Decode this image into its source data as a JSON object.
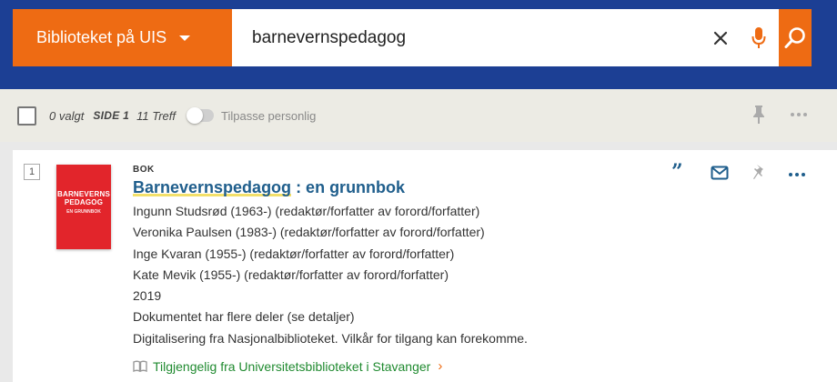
{
  "search": {
    "scope_label": "Biblioteket på UIS",
    "query": "barnevernspedagog"
  },
  "toolbar": {
    "selected": "0 valgt",
    "page": "SIDE 1",
    "hits": "11 Treff",
    "personalize_label": "Tilpasse personlig"
  },
  "results": [
    {
      "index": "1",
      "cover_title": "BARNEVERNS PEDAGOG",
      "cover_subtitle": "EN GRUNNBOK",
      "type": "BOK",
      "title_highlight": "Barnevernspedagog",
      "title_rest": " : en grunnbok",
      "details": [
        "Ingunn Studsrød (1963-) (redaktør/forfatter av forord/forfatter)",
        "Veronika Paulsen (1983-) (redaktør/forfatter av forord/forfatter)",
        "Inge Kvaran (1955-) (redaktør/forfatter av forord/forfatter)",
        "Kate Mevik (1955-) (redaktør/forfatter av forord/forfatter)",
        "2019",
        "Dokumentet har flere deler (se detaljer)",
        "Digitalisering fra Nasjonalbiblioteket. Vilkår for tilgang kan forekomme."
      ],
      "availability": "Tilgjengelig fra Universitetsbiblioteket i Stavanger"
    }
  ],
  "colors": {
    "header_bg": "#1c3f94",
    "accent": "#ee6b13",
    "link": "#1f5e8c",
    "available": "#1f8a2f"
  }
}
